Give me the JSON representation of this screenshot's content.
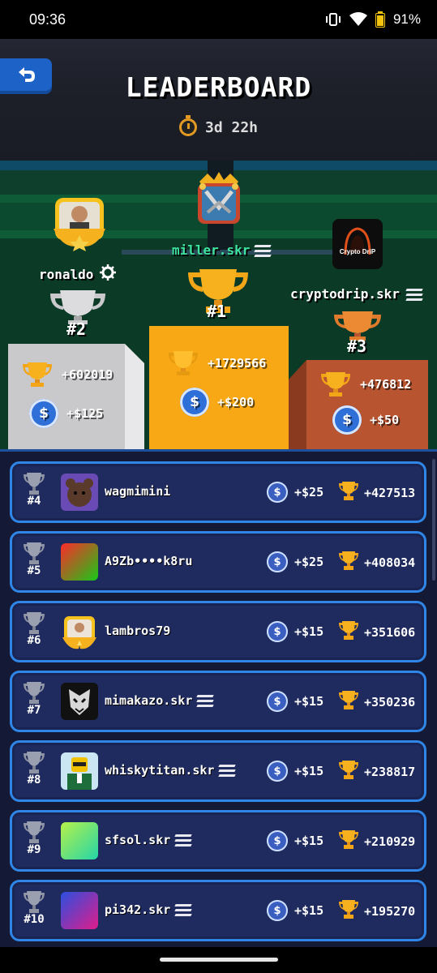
{
  "status_bar": {
    "time": "09:36",
    "battery": "91%"
  },
  "header": {
    "title": "LEADERBOARD",
    "timer": "3d 22h"
  },
  "colors": {
    "gold": "#f2a516",
    "silver": "#c9c9cb",
    "bronze": "#b8542f",
    "accent_blue": "#2f86e6",
    "usdc": "#2f6fd8"
  },
  "podium": {
    "first": {
      "name": "miller.skr",
      "rank": "#1",
      "score": "+1729566",
      "reward": "+$200"
    },
    "second": {
      "name": "ronaldo",
      "rank": "#2",
      "score": "+602019",
      "reward": "+$125"
    },
    "third": {
      "name": "cryptodrip.skr",
      "rank": "#3",
      "score": "+476812",
      "reward": "+$50",
      "avatar_text": "Crypto DriP"
    }
  },
  "list": [
    {
      "rank": "#4",
      "name": "wagmimini",
      "reward": "+$25",
      "score": "+427513"
    },
    {
      "rank": "#5",
      "name": "A9Zb••••k8ru",
      "reward": "+$25",
      "score": "+408034"
    },
    {
      "rank": "#6",
      "name": "lambros79",
      "reward": "+$15",
      "score": "+351606"
    },
    {
      "rank": "#7",
      "name": "mimakazo.skr",
      "reward": "+$15",
      "score": "+350236"
    },
    {
      "rank": "#8",
      "name": "whiskytitan.skr",
      "reward": "+$15",
      "score": "+238817"
    },
    {
      "rank": "#9",
      "name": "sfsol.skr",
      "reward": "+$15",
      "score": "+210929"
    },
    {
      "rank": "#10",
      "name": "pi342.skr",
      "reward": "+$15",
      "score": "+195270"
    }
  ],
  "icons": {
    "usdc": "$"
  }
}
